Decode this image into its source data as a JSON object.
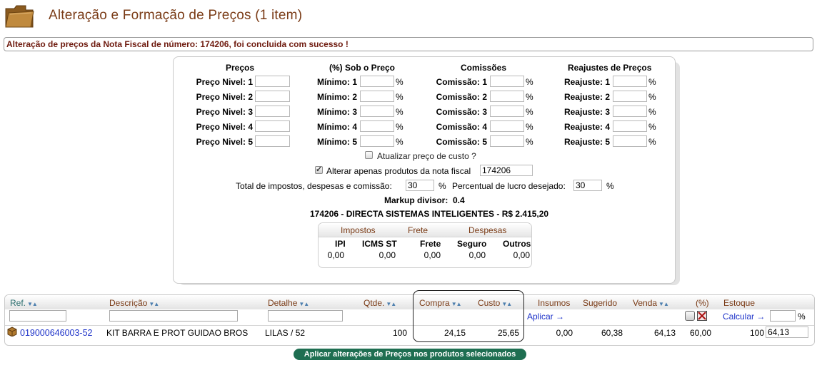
{
  "header": {
    "title": "Alteração e Formação de Preços (1 item)",
    "message": "Alteração de preços da Nota Fiscal de número: 174206, foi concluida com sucesso !"
  },
  "form": {
    "col_headers": [
      "Preços",
      "(%) Sob o Preço",
      "Comissões",
      "Reajustes de Preços"
    ],
    "precos": [
      "Preço Nivel: 1",
      "Preço Nivel: 2",
      "Preço Nivel: 3",
      "Preço Nivel: 4",
      "Preço Nivel: 5"
    ],
    "minimos": [
      "Mínimo: 1",
      "Mínimo: 2",
      "Mínimo: 3",
      "Mínimo: 4",
      "Mínimo: 5"
    ],
    "comissoes": [
      "Comissão: 1",
      "Comissão: 2",
      "Comissão: 3",
      "Comissão: 4",
      "Comissão: 5"
    ],
    "reajustes": [
      "Reajuste: 1",
      "Reajuste: 2",
      "Reajuste: 3",
      "Reajuste: 4",
      "Reajuste: 5"
    ],
    "percent_sign": "%",
    "atualizar_custo_label": "Atualizar preço de custo ?",
    "atualizar_custo_checked": false,
    "alterar_nf_label": "Alterar apenas produtos da nota fiscal",
    "alterar_nf_checked": true,
    "nota_fiscal_value": "174206",
    "total_impostos_label": "Total de impostos, despesas e comissão:",
    "total_impostos_value": "30",
    "lucro_label": "Percentual de lucro desejado:",
    "lucro_value": "30",
    "markup_label": "Markup divisor:",
    "markup_value": "0.4",
    "nota_summary": "174206 - DIRECTA SISTEMAS INTELIGENTES - R$ 2.415,20"
  },
  "taxes": {
    "groups": [
      "Impostos",
      "Frete",
      "Despesas"
    ],
    "columns": [
      "IPI",
      "ICMS ST",
      "Frete",
      "Seguro",
      "Outros"
    ],
    "values": [
      "0,00",
      "0,00",
      "0,00",
      "0,00",
      "0,00"
    ]
  },
  "grid": {
    "headers": {
      "ref": "Ref.",
      "descricao": "Descrição",
      "detalhe": "Detalhe",
      "qtde": "Qtde.",
      "compra": "Compra",
      "custo": "Custo",
      "insumos": "Insumos",
      "sugerido": "Sugerido",
      "venda": "Venda",
      "pct": "(%)",
      "estoque": "Estoque"
    },
    "sort_glyph": "▼▲",
    "aplicar_label": "Aplicar →",
    "calcular_label": "Calcular →",
    "calc_pct_sign": "%",
    "row": {
      "ref": "019000646003-52",
      "descricao": "KIT BARRA E PROT GUIDAO BROS",
      "detalhe": "LILAS / 52",
      "qtde": "100",
      "compra": "24,15",
      "custo": "25,65",
      "insumos": "0,00",
      "sugerido": "60,38",
      "venda": "64,13",
      "pct": "60,00",
      "estoque": "100",
      "novo_preco": "64,13"
    }
  },
  "apply_button": "Aplicar alterações de Preços nos produtos selecionados"
}
